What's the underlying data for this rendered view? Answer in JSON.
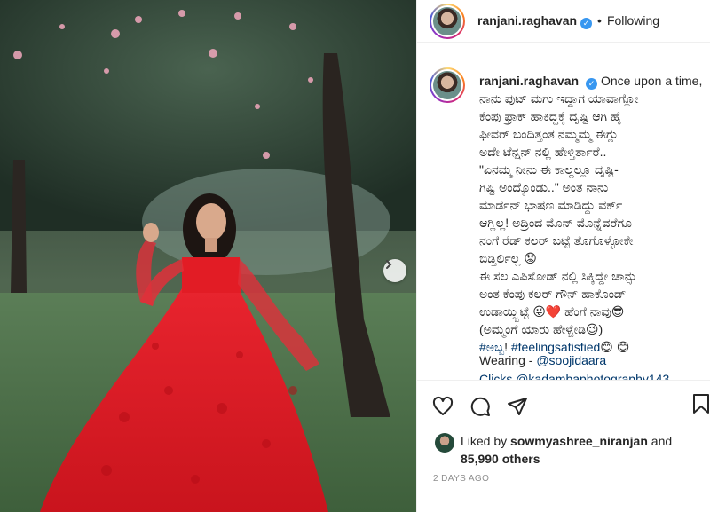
{
  "header": {
    "username": "ranjani.raghavan",
    "verified_mark": "✓",
    "separator": "•",
    "follow_status": "Following"
  },
  "caption": {
    "username": "ranjani.raghavan",
    "lines": [
      "Once upon a time,",
      "ನಾನು ಪುಟ್ ಮಗು ಇದ್ದಾಗ ಯಾವಾಗ್ಲೋ",
      "ಕೆಂಪು ಫ್ರಾಕ್ ಹಾಕಿದ್ದಕ್ಕೆ ದೃಷ್ಟಿ ಆಗಿ ಹೈ",
      "ಫೀವರ್ ಬಂದಿತ್ತಂತ ನಮ್ಮಮ್ಮ ಈಗ್ಲು",
      "ಅದೇ ಟೆನ್ಷನ್ ನಲ್ಲಿ ಹೇಳ್ತಿರ್ತಾರೆ..",
      "\"ಏನಮ್ಮ ನೀನು ಈ ಕಾಲ್ದಲ್ಲೂ ದೃಷ್ಟಿ-",
      "ಗಿಷ್ಟಿ ಅಂದ್ಕೊಂಡು..\" ಅಂತ ನಾನು",
      "ಮಾರ್ಡನ್ ಭಾಷಣ ಮಾಡಿದ್ದು ವರ್ಕ್",
      "ಆಗ್ಲಿಲ್ಲ! ಅದ್ರಿಂದ ಮೊನ್ ಮೊನ್ನೆವರೆಗೂ",
      "ನಂಗೆ ರೆಡ್ ಕಲರ್ ಬಟ್ಟೆ ತೊಗೊಳ್ಳೋಕೇ",
      "ಬಿಡ್ತಿರ್ಲಿಲ್ಲ 😟",
      "ಈ ಸಲ ಎಪಿಸೋಡ್ ನಲ್ಲಿ ಸಿಕ್ಕಿದ್ದೇ ಚಾನ್ಸು",
      "ಅಂತ ಕೆಂಪು ಕಲರ್ ಗೌನ್ ಹಾಕೊಂಡ್",
      "ಉಡಾಯ್ಸ್ಬಿಟ್ಟೆ 😜❤️ ಹೆಂಗೆ ನಾವು😎",
      "(ಅಮ್ಮಂಗೆ ಯಾರು ಹೇಳ್ಬೇಡಿ😉)"
    ],
    "hashtag_1": "#ಅಬ್ಬ",
    "hashtag_sep": "! ",
    "hashtag_2": "#feelingsatisfied",
    "hashtag_tail": "😊 😊",
    "wearing_label": "Wearing - ",
    "wearing_mention": "@soojidaara",
    "credit_partial": "Clicks @kadambaphotography143"
  },
  "actions": {
    "like_icon": "heart-icon",
    "comment_icon": "comment-icon",
    "share_icon": "share-icon",
    "save_icon": "bookmark-icon"
  },
  "likes": {
    "prefix": "Liked by ",
    "user": "sowmyashree_niranjan",
    "middle": " and",
    "count": "85,990 others"
  },
  "timestamp": "2 DAYS AGO",
  "colors": {
    "dress_red": "#e21c25",
    "link_blue": "#00376b",
    "verified_blue": "#3897f0",
    "muted_gray": "#8e8e8e"
  }
}
